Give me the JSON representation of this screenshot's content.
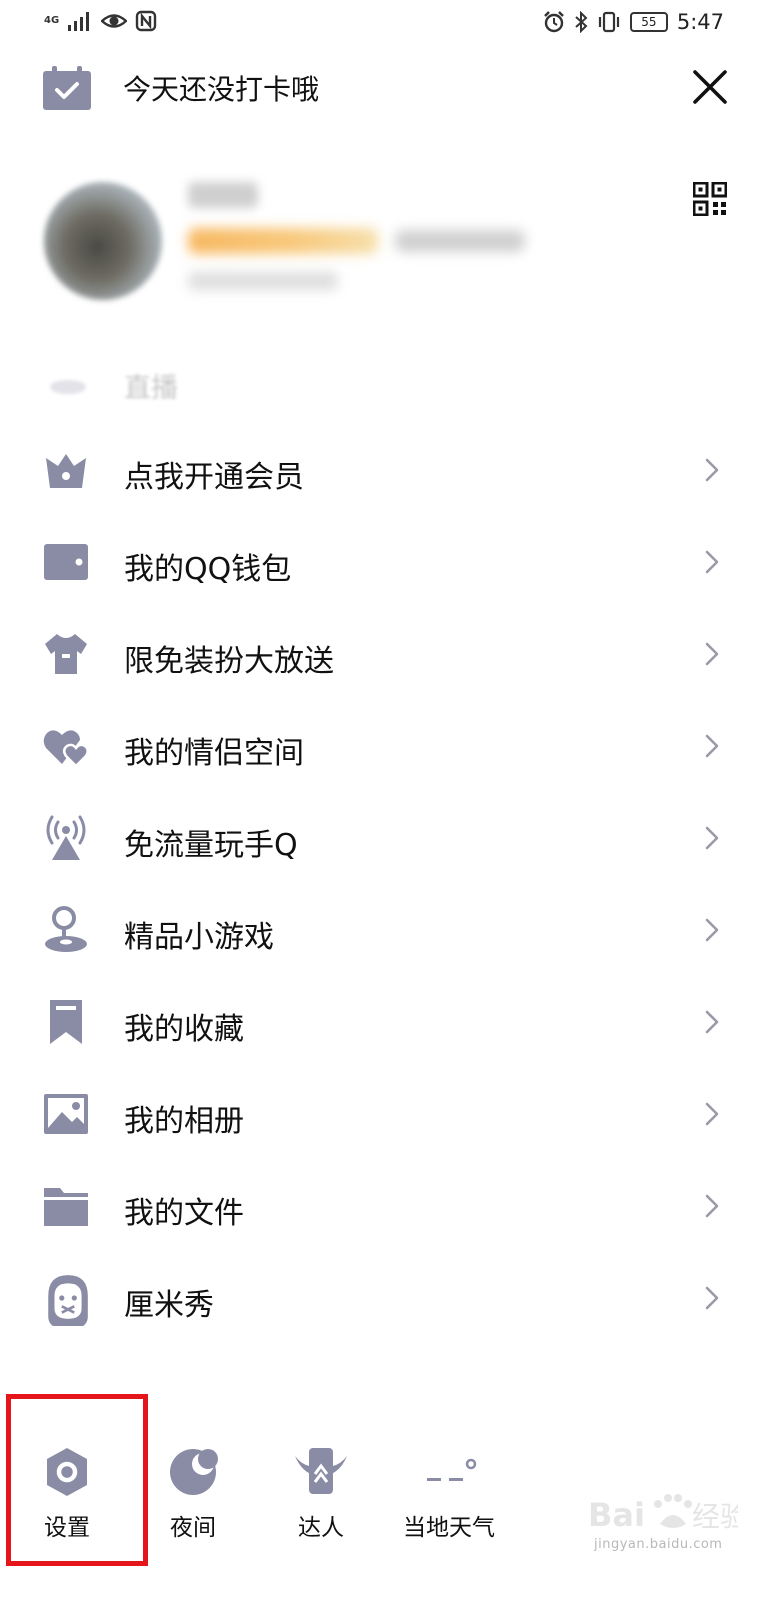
{
  "status_bar": {
    "network": "4G",
    "time": "5:47",
    "battery": "55"
  },
  "checkin": {
    "text": "今天还没打卡哦"
  },
  "faded_item": {
    "label": "直播"
  },
  "menu": {
    "items": [
      {
        "label": "点我开通会员",
        "icon": "crown-icon"
      },
      {
        "label": "我的QQ钱包",
        "icon": "wallet-icon"
      },
      {
        "label": "限免装扮大放送",
        "icon": "tshirt-icon"
      },
      {
        "label": "我的情侣空间",
        "icon": "hearts-icon"
      },
      {
        "label": "免流量玩手Q",
        "icon": "antenna-icon"
      },
      {
        "label": "精品小游戏",
        "icon": "game-pin-icon"
      },
      {
        "label": "我的收藏",
        "icon": "bookmark-icon"
      },
      {
        "label": "我的相册",
        "icon": "image-icon"
      },
      {
        "label": "我的文件",
        "icon": "folder-icon"
      },
      {
        "label": "厘米秀",
        "icon": "cmshow-avatar-icon"
      }
    ]
  },
  "bottom_bar": {
    "items": [
      {
        "label": "设置",
        "icon": "settings-hex-icon"
      },
      {
        "label": "夜间",
        "icon": "moon-icon"
      },
      {
        "label": "达人",
        "icon": "winged-badge-icon"
      },
      {
        "label": "当地天气",
        "icon": "weather-icon"
      }
    ]
  },
  "highlight_color": "#e4161b",
  "icon_color": "#8a8ca6"
}
